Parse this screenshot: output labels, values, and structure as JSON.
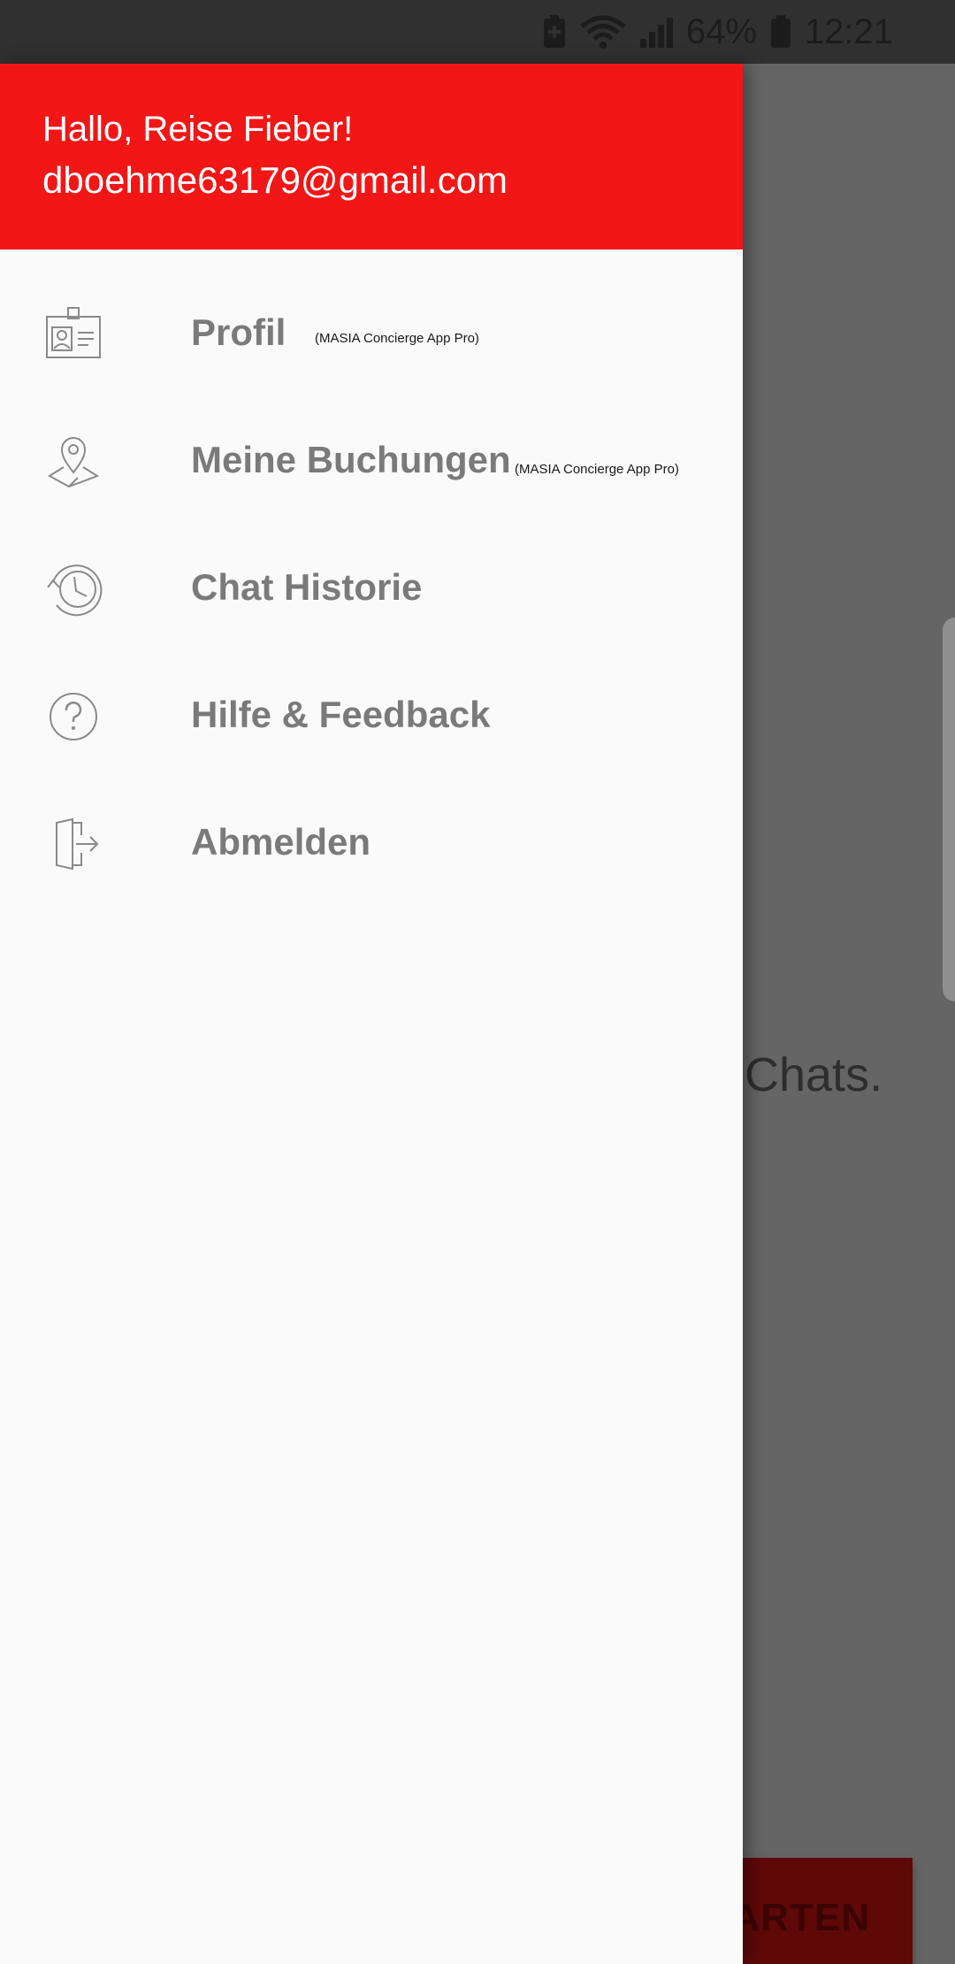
{
  "status_bar": {
    "battery_percent": "64%",
    "time": "12:21",
    "icons": [
      "battery-saver-icon",
      "wifi-icon",
      "signal-icon",
      "battery-icon"
    ]
  },
  "drawer": {
    "greeting": "Hallo, Reise Fieber!",
    "email": "dboehme63179@gmail.com",
    "header_color": "#f21616",
    "items": [
      {
        "label": "Profil",
        "tag": "(MASIA Concierge App Pro)",
        "icon": "id-card-icon"
      },
      {
        "label": "Meine Buchungen",
        "tag": "(MASIA Concierge App Pro)",
        "icon": "map-pin-icon"
      },
      {
        "label": "Chat Historie",
        "tag": "",
        "icon": "history-clock-icon"
      },
      {
        "label": "Hilfe & Feedback",
        "tag": "",
        "icon": "help-circle-icon"
      },
      {
        "label": "Abmelden",
        "tag": "",
        "icon": "logout-icon"
      }
    ]
  },
  "background": {
    "chats_text": "Chats.",
    "start_button_label": "TARTEN",
    "button_color": "#5f0808"
  }
}
